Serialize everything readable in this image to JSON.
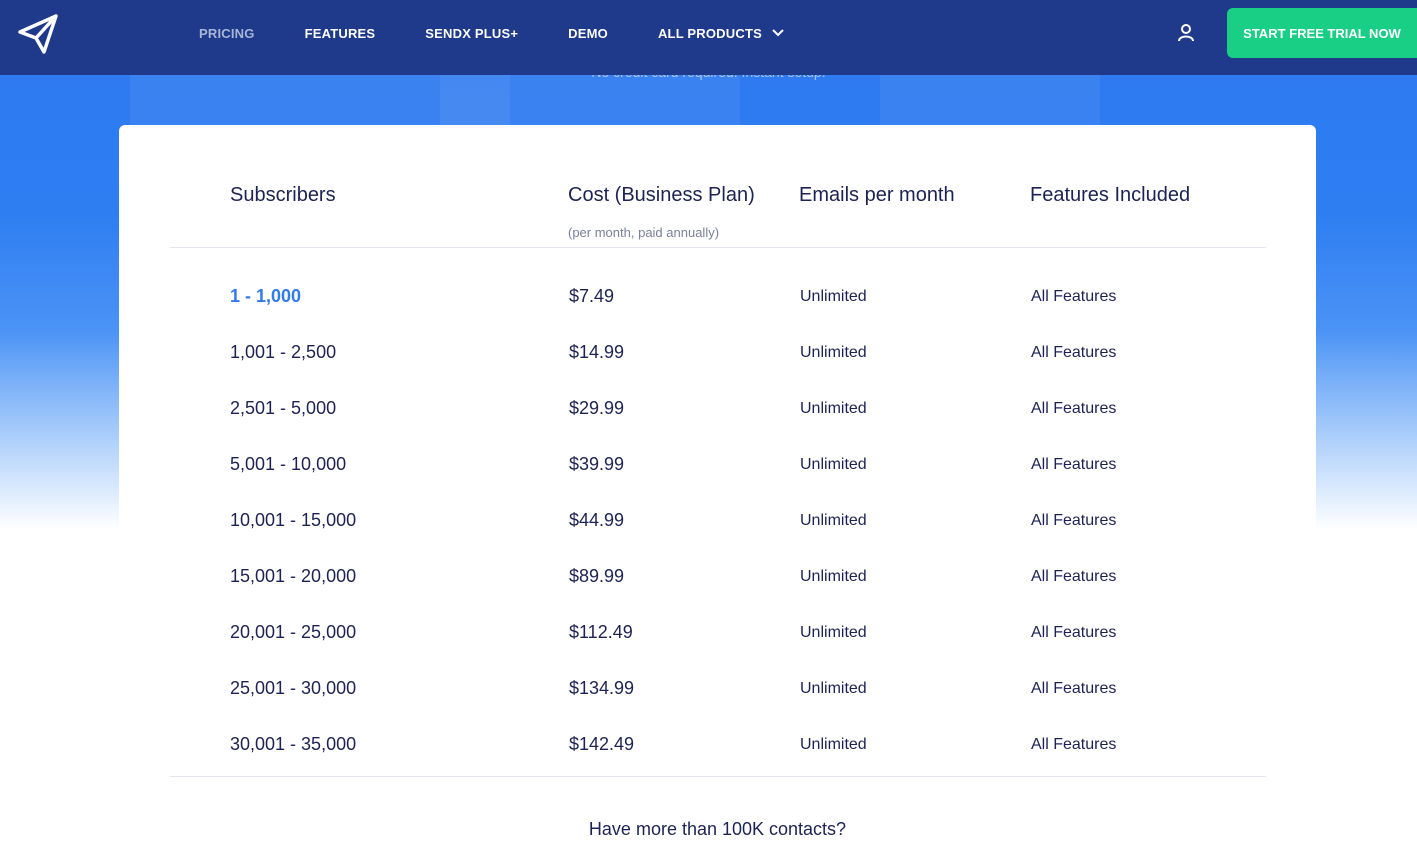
{
  "nav": {
    "links": [
      "PRICING",
      "FEATURES",
      "SENDX PLUS+",
      "DEMO",
      "ALL PRODUCTS"
    ],
    "cta": "START FREE TRIAL NOW"
  },
  "hero": {
    "subtext": "No credit card required. Instant setup."
  },
  "table": {
    "headers": {
      "subscribers": "Subscribers",
      "cost": "Cost (Business Plan)",
      "cost_note": "(per month, paid annually)",
      "emails": "Emails per month",
      "features": "Features Included"
    },
    "rows": [
      {
        "subscribers": "1 - 1,000",
        "cost": "$7.49",
        "emails": "Unlimited",
        "features": "All Features"
      },
      {
        "subscribers": "1,001 - 2,500",
        "cost": "$14.99",
        "emails": "Unlimited",
        "features": "All Features"
      },
      {
        "subscribers": "2,501 - 5,000",
        "cost": "$29.99",
        "emails": "Unlimited",
        "features": "All Features"
      },
      {
        "subscribers": "5,001 - 10,000",
        "cost": "$39.99",
        "emails": "Unlimited",
        "features": "All Features"
      },
      {
        "subscribers": "10,001 - 15,000",
        "cost": "$44.99",
        "emails": "Unlimited",
        "features": "All Features"
      },
      {
        "subscribers": "15,001 - 20,000",
        "cost": "$89.99",
        "emails": "Unlimited",
        "features": "All Features"
      },
      {
        "subscribers": "20,001 - 25,000",
        "cost": "$112.49",
        "emails": "Unlimited",
        "features": "All Features"
      },
      {
        "subscribers": "25,001 - 30,000",
        "cost": "$134.99",
        "emails": "Unlimited",
        "features": "All Features"
      },
      {
        "subscribers": "30,001 - 35,000",
        "cost": "$142.49",
        "emails": "Unlimited",
        "features": "All Features"
      }
    ]
  },
  "footer_prompt": "Have more than 100K contacts?",
  "colors": {
    "nav_bg": "#1f3a8a",
    "cta_bg": "#19cf86",
    "highlight": "#2f7be8",
    "text": "#1c2352"
  }
}
